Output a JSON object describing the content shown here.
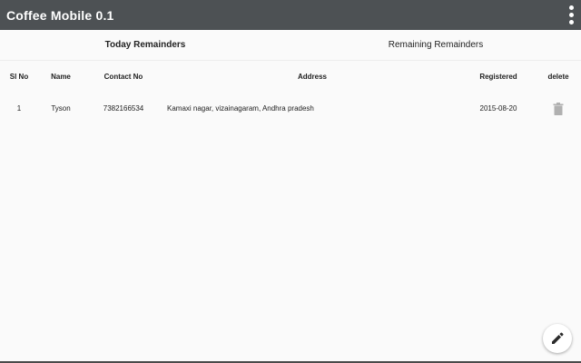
{
  "app": {
    "title": "Coffee Mobile 0.1"
  },
  "icons": {
    "overflow": "more-vert-icon",
    "delete": "trash-icon",
    "edit": "pencil-icon"
  },
  "colors": {
    "actionbar": "#4d5154",
    "background": "#fafafa",
    "icon_gray": "#b0b0b0"
  },
  "tabs": [
    {
      "label": "Today Remainders",
      "active": true
    },
    {
      "label": "Remaining Remainders",
      "active": false
    }
  ],
  "table": {
    "headers": {
      "sl_no": "Sl No",
      "name": "Name",
      "contact": "Contact No",
      "address": "Address",
      "registered": "Registered",
      "delete": "delete"
    },
    "rows": [
      {
        "sl_no": "1",
        "name": "Tyson",
        "contact": "7382166534",
        "address": "Kamaxi nagar, vizainagaram, Andhra pradesh",
        "registered": "2015-08-20"
      }
    ]
  }
}
